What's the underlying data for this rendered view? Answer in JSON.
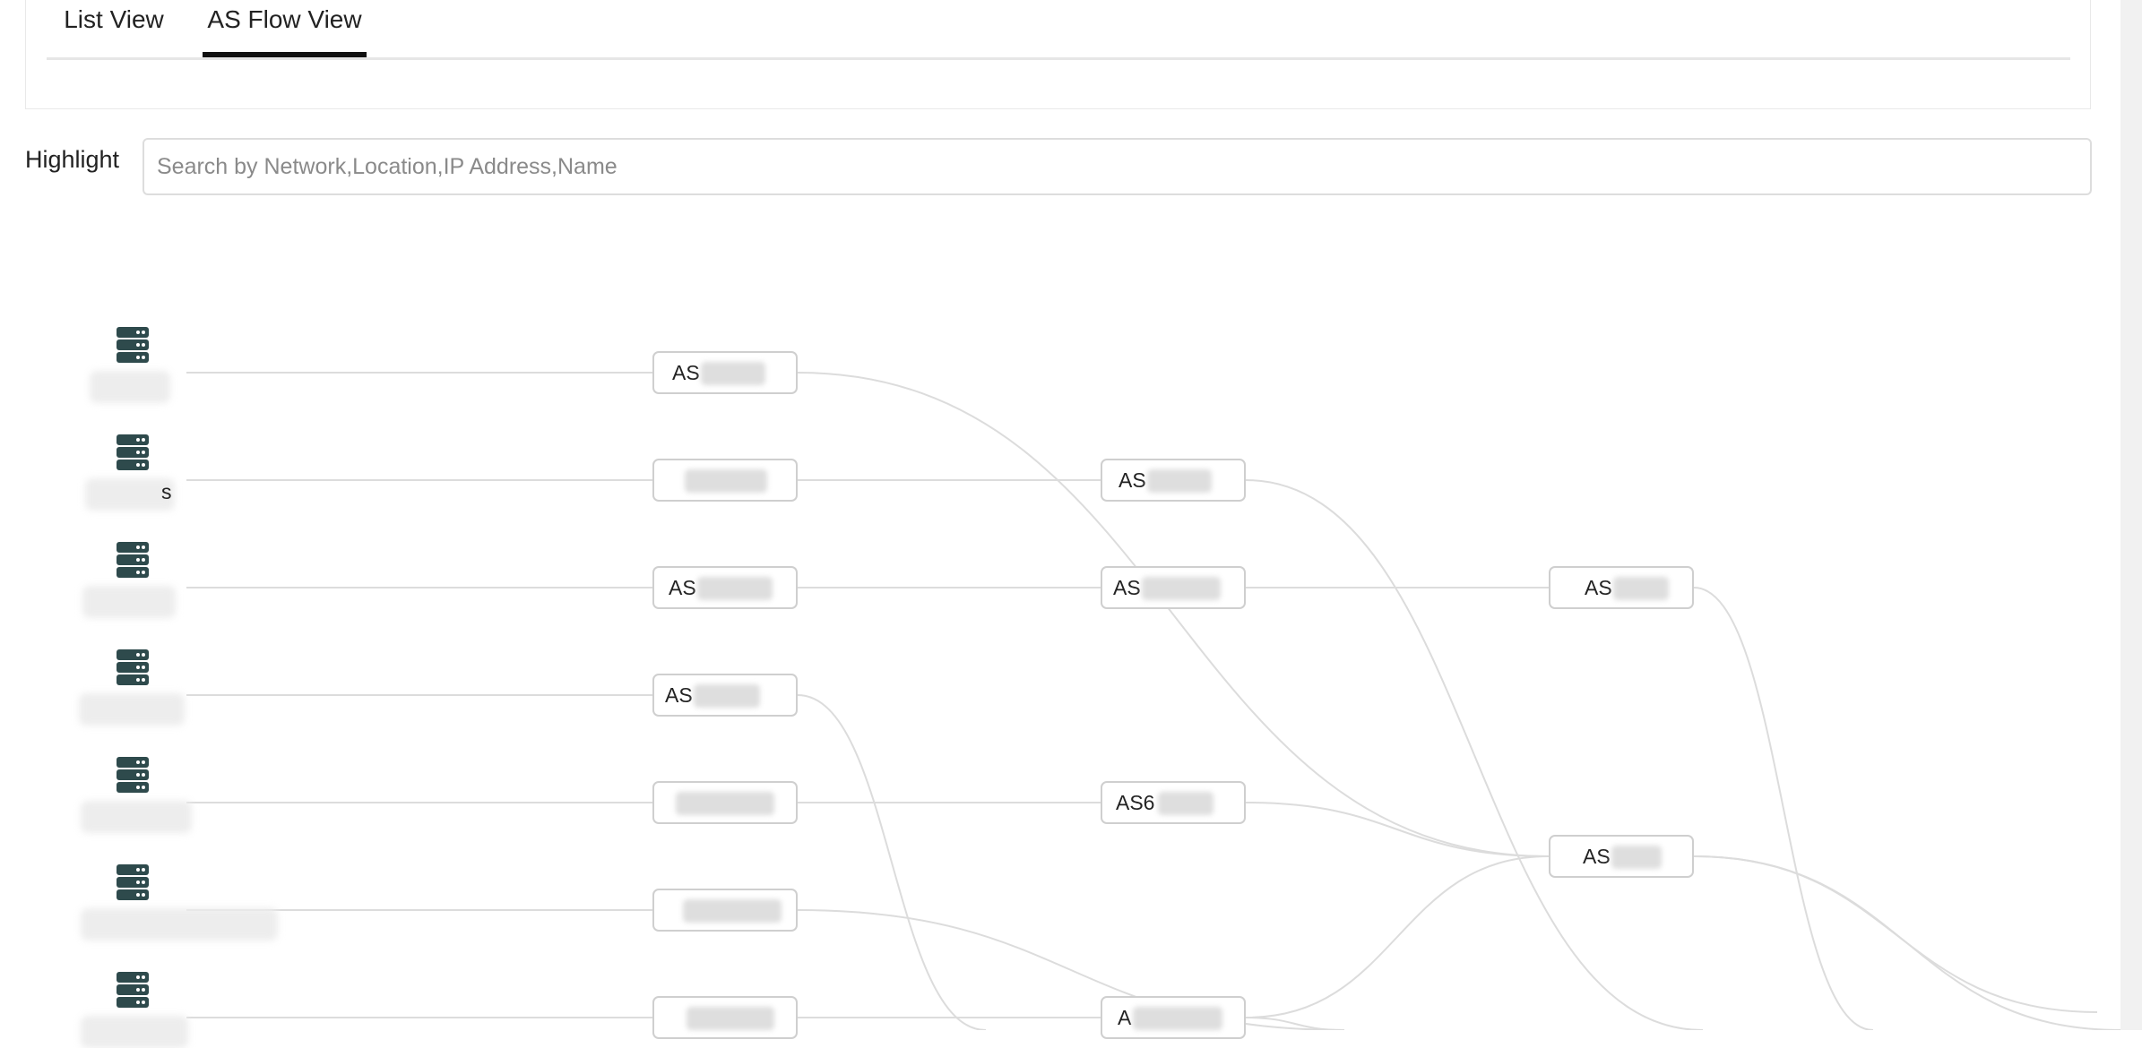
{
  "tabs": [
    {
      "label": "List View",
      "active": false
    },
    {
      "label": "AS Flow View",
      "active": true
    }
  ],
  "highlight": {
    "label": "Highlight",
    "placeholder": "Search by Network,Location,IP Address,Name"
  },
  "sources": [
    {
      "icon": "server-icon",
      "name_tail": ""
    },
    {
      "icon": "server-icon",
      "name_tail": "s"
    },
    {
      "icon": "server-icon",
      "name_tail": ""
    },
    {
      "icon": "server-icon",
      "name_tail": ""
    },
    {
      "icon": "server-icon",
      "name_tail": ""
    },
    {
      "icon": "server-icon",
      "name_tail": ""
    },
    {
      "icon": "server-icon",
      "name_tail": ""
    }
  ],
  "nodes": [
    {
      "label": "AS"
    },
    {
      "label": ""
    },
    {
      "label": "AS"
    },
    {
      "label": "AS"
    },
    {
      "label": ""
    },
    {
      "label": ""
    },
    {
      "label": ""
    },
    {
      "label": "AS"
    },
    {
      "label": "AS"
    },
    {
      "label": "AS6"
    },
    {
      "label": "A"
    },
    {
      "label": "AS"
    },
    {
      "label": "AS"
    }
  ],
  "colors": {
    "icon": "#2e4a4c",
    "link": "#dcdcdc",
    "node_border": "#cfcfcf",
    "active_tab_underline": "#111111"
  }
}
